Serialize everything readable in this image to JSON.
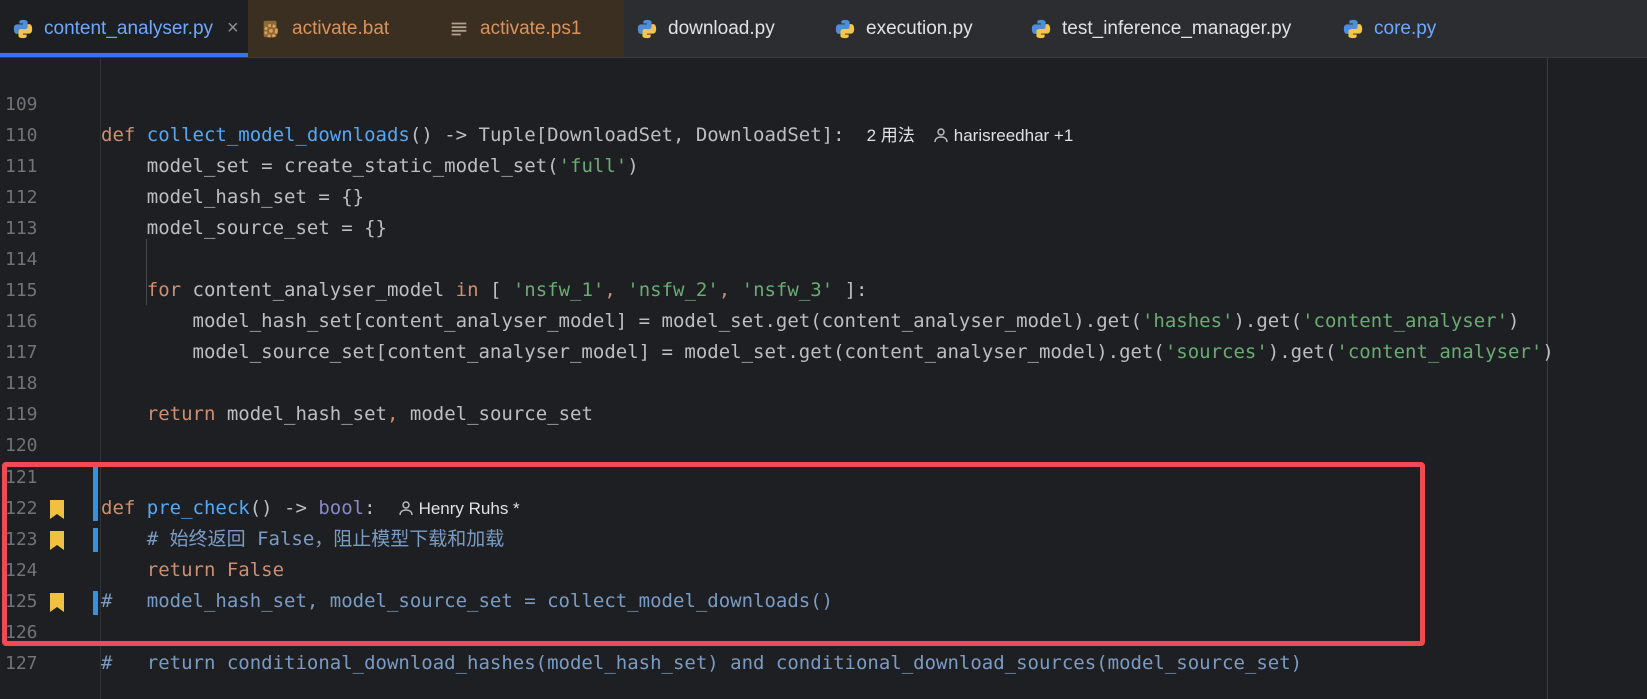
{
  "tabs": [
    {
      "label": "content_analyser.py",
      "icon": "python-icon",
      "active": true,
      "close": "×"
    },
    {
      "label": "activate.bat",
      "icon": "gear-file-icon"
    },
    {
      "label": "activate.ps1",
      "icon": "text-file-icon"
    },
    {
      "label": "download.py",
      "icon": "python-icon"
    },
    {
      "label": "execution.py",
      "icon": "python-icon"
    },
    {
      "label": "test_inference_manager.py",
      "icon": "python-icon"
    },
    {
      "label": "core.py",
      "icon": "python-icon"
    }
  ],
  "code": {
    "l109": {
      "num": "109",
      "kw": "def ",
      "name": "collect_model_downloads",
      "rest": "() -> Tuple[DownloadSet, DownloadSet]:",
      "usages": "2 用法",
      "author": "harisreedhar +1"
    },
    "l110": {
      "num": "110",
      "pre": "    model_set = create_static_model_set(",
      "s": "'full'",
      "post": ")"
    },
    "l111": {
      "num": "111",
      "text": "    model_hash_set = {}"
    },
    "l112": {
      "num": "112",
      "text": "    model_source_set = {}"
    },
    "l113": {
      "num": "113"
    },
    "l114": {
      "num": "114",
      "kw1": "    for ",
      "v": "content_analyser_model ",
      "kw2": "in",
      "a": " [ ",
      "s1": "'nsfw_1'",
      "c1": ", ",
      "s2": "'nsfw_2'",
      "c2": ", ",
      "s3": "'nsfw_3'",
      "b": " ]:"
    },
    "l115": {
      "num": "115",
      "pre": "        model_hash_set[content_analyser_model] = model_set.get(content_analyser_model).get(",
      "s1": "'hashes'",
      "mid": ").get(",
      "s2": "'content_analyser'",
      "post": ")"
    },
    "l116": {
      "num": "116",
      "pre": "        model_source_set[content_analyser_model] = model_set.get(content_analyser_model).get(",
      "s1": "'sources'",
      "mid": ").get(",
      "s2": "'content_analyser'",
      "post": ")"
    },
    "l117": {
      "num": "117"
    },
    "l118": {
      "num": "118",
      "kw": "    return ",
      "a": "model_hash_set",
      "comma": ",",
      "b": " model_source_set"
    },
    "l119": {
      "num": "119"
    },
    "l120": {
      "num": "120"
    },
    "l121": {
      "num": "121",
      "kw": "def ",
      "name": "pre_check",
      "a": "() -> ",
      "type": "bool",
      "b": ":",
      "author": "Henry Ruhs *"
    },
    "l122": {
      "num": "122",
      "text": "    # 始终返回 False，阻止模型下载和加载"
    },
    "l123": {
      "num": "123",
      "text": "    return False"
    },
    "l124": {
      "num": "124",
      "text": "#   model_hash_set, model_source_set = collect_model_downloads()"
    },
    "l125": {
      "num": "125"
    },
    "l126": {
      "num": "126",
      "text": "#   return conditional_download_hashes(model_hash_set) and conditional_download_sources(model_source_set)"
    },
    "l127": {
      "num": "127"
    }
  },
  "colors": {
    "highlight_box": "#f04b55",
    "change_bar": "#3592e0",
    "bookmark": "#f0c040"
  }
}
